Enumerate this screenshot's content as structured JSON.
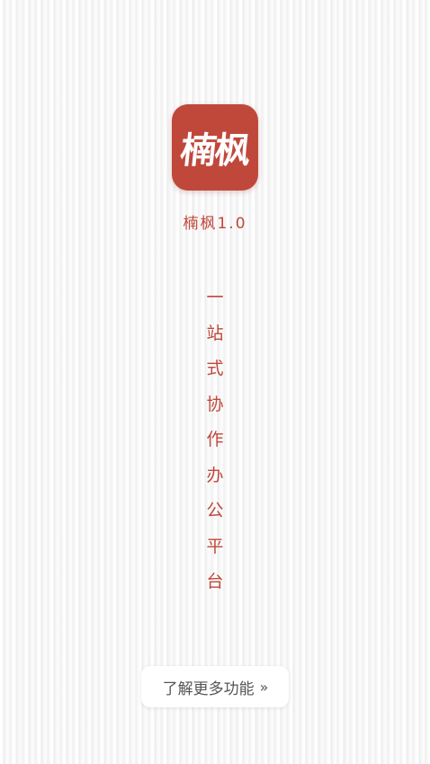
{
  "app": {
    "logo_text": "楠枫",
    "version_label": "楠枫1.0"
  },
  "tagline": {
    "chars": [
      "一",
      "站",
      "式",
      "协",
      "作",
      "办",
      "公",
      "平",
      "台"
    ]
  },
  "more_button": {
    "label": "了解更多功能",
    "icon": "double-chevron-right-icon",
    "icon_glyph": "»"
  },
  "colors": {
    "accent": "#c0483b",
    "background": "#f6f6f6",
    "button_bg": "#ffffff",
    "button_text": "#555555"
  }
}
